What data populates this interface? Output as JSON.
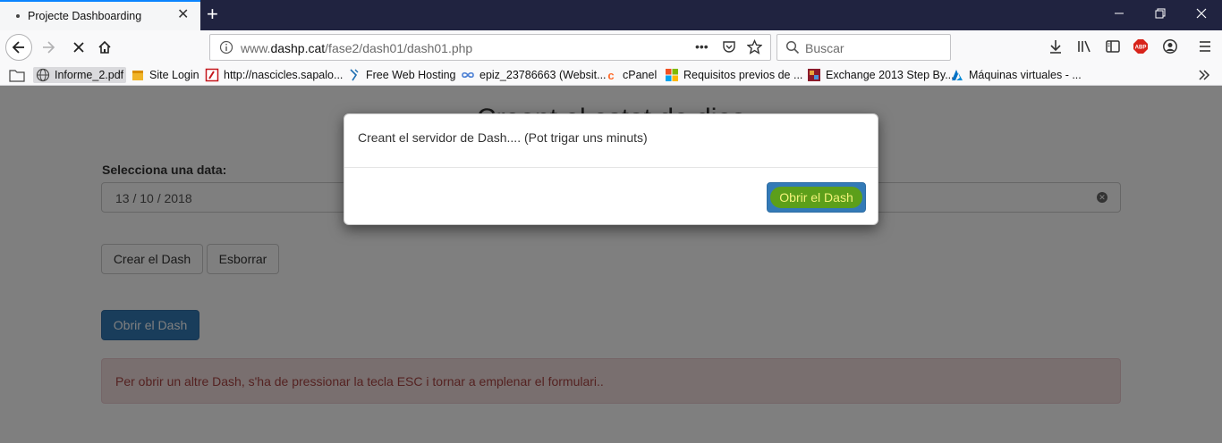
{
  "browser": {
    "tab_title": "Projecte Dashboarding",
    "url_prefix": "www.",
    "url_domain": "dashp.cat",
    "url_path": "/fase2/dash01/dash01.php",
    "search_placeholder": "Buscar",
    "bookmarks": [
      {
        "label": "Informe_2.pdf",
        "icon": "globe-icon"
      },
      {
        "label": "Site Login",
        "icon": "box-icon"
      },
      {
        "label": "http://nascicles.sapalo...",
        "icon": "pdf-icon"
      },
      {
        "label": "Free Web Hosting",
        "icon": "hosting-icon"
      },
      {
        "label": "epiz_23786663 (Websit...",
        "icon": "infinity-icon"
      },
      {
        "label": "cPanel",
        "icon": "cpanel-icon"
      },
      {
        "label": "Requisitos previos de ...",
        "icon": "microsoft-icon"
      },
      {
        "label": "Exchange 2013 Step By...",
        "icon": "exchange-icon"
      },
      {
        "label": "Máquinas virtuales - ...",
        "icon": "azure-icon"
      }
    ]
  },
  "page": {
    "title": "Creant el estat de dies",
    "date_label": "Selecciona una data:",
    "date_value": "13 / 10 / 2018",
    "create_button": "Crear el Dash",
    "clear_button": "Esborrar",
    "open_button": "Obrir el Dash",
    "alert_text": "Per obrir un altre Dash, s'ha de pressionar la tecla ESC i tornar a emplenar el formulari.."
  },
  "modal": {
    "message": "Creant el servidor de Dash.... (Pot trigar uns minuts)",
    "button": "Obrir el Dash"
  },
  "colors": {
    "tabstrip": "#202340",
    "primary": "#337ab7",
    "alert_bg": "#f2dede",
    "alert_text": "#a94442",
    "highlight": "#5c9f1a"
  }
}
